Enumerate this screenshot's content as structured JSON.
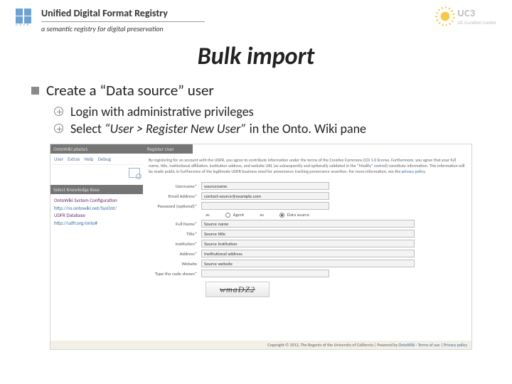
{
  "header": {
    "title": "Unified Digital Format Registry",
    "subtitle": "a semantic registry for digital preservation",
    "uc3": {
      "brand": "UC3",
      "org": "UC Curation Center"
    }
  },
  "slide": {
    "title": "Bulk import"
  },
  "bullets": {
    "level1": "Create a “Data source” user",
    "sub1": "Login with administrative privileges",
    "sub2_pre": "Select ",
    "sub2_ital": "“User > Register New User”",
    "sub2_post": " in the Onto. Wiki pane"
  },
  "shot": {
    "left_tab": "OntoWiki pbeta1",
    "menu": [
      "User",
      "Extras",
      "Help",
      "Debug"
    ],
    "kb_header": "Select Knowledge Base",
    "kb": [
      {
        "name": "OntoWiki System Configuration",
        "url": "http://ns.ontowiki.net/SysOnt/"
      },
      {
        "name": "UDFR Database",
        "url": "http://udfr.org/onto#"
      }
    ],
    "right_tab": "Register User",
    "disclaimer_1": "By registering for an account with the UDFR, you agree to contribute information under the terms of the Creative Commons ",
    "disclaimer_link1": "CC0 1.0",
    "disclaimer_2": " license. Furthermore, you agree that your full name, title, institutional affiliation, institution address, and website URL (as subsequently and optionally validated in the “Modify” control) constitute information. This information will be made public in furtherance of the legitimate UDFR business need for provenance tracking provenance assertion. For more information, see the ",
    "disclaimer_link2": "privacy policy",
    "form": {
      "username_label": "Username*",
      "username_value": "sourcename",
      "email_label": "Email Address*",
      "email_value": "contact-source@example.com",
      "password_label": "Password (optional)*",
      "role_label": "as",
      "role1": "Agent",
      "role2": "Data source",
      "fullname_label": "Full Name*",
      "fullname_value": "Source name",
      "title_label": "Title*",
      "title_value": "Source title",
      "institution_label": "Institution*",
      "institution_value": "Source institution",
      "address_label": "Address*",
      "address_value": "Institutional address",
      "website_label": "Website",
      "website_value": "Source website",
      "captcha_label": "Type the code shown*",
      "captcha_text": "wmaDZ2"
    },
    "footer_1": "Copyright © 2012, The Regents of the University of California | Powered by ",
    "footer_link1": "OntoWiki",
    "footer_sep": " · ",
    "footer_link2": "Terms of use",
    "footer_link3": "Privacy policy"
  }
}
